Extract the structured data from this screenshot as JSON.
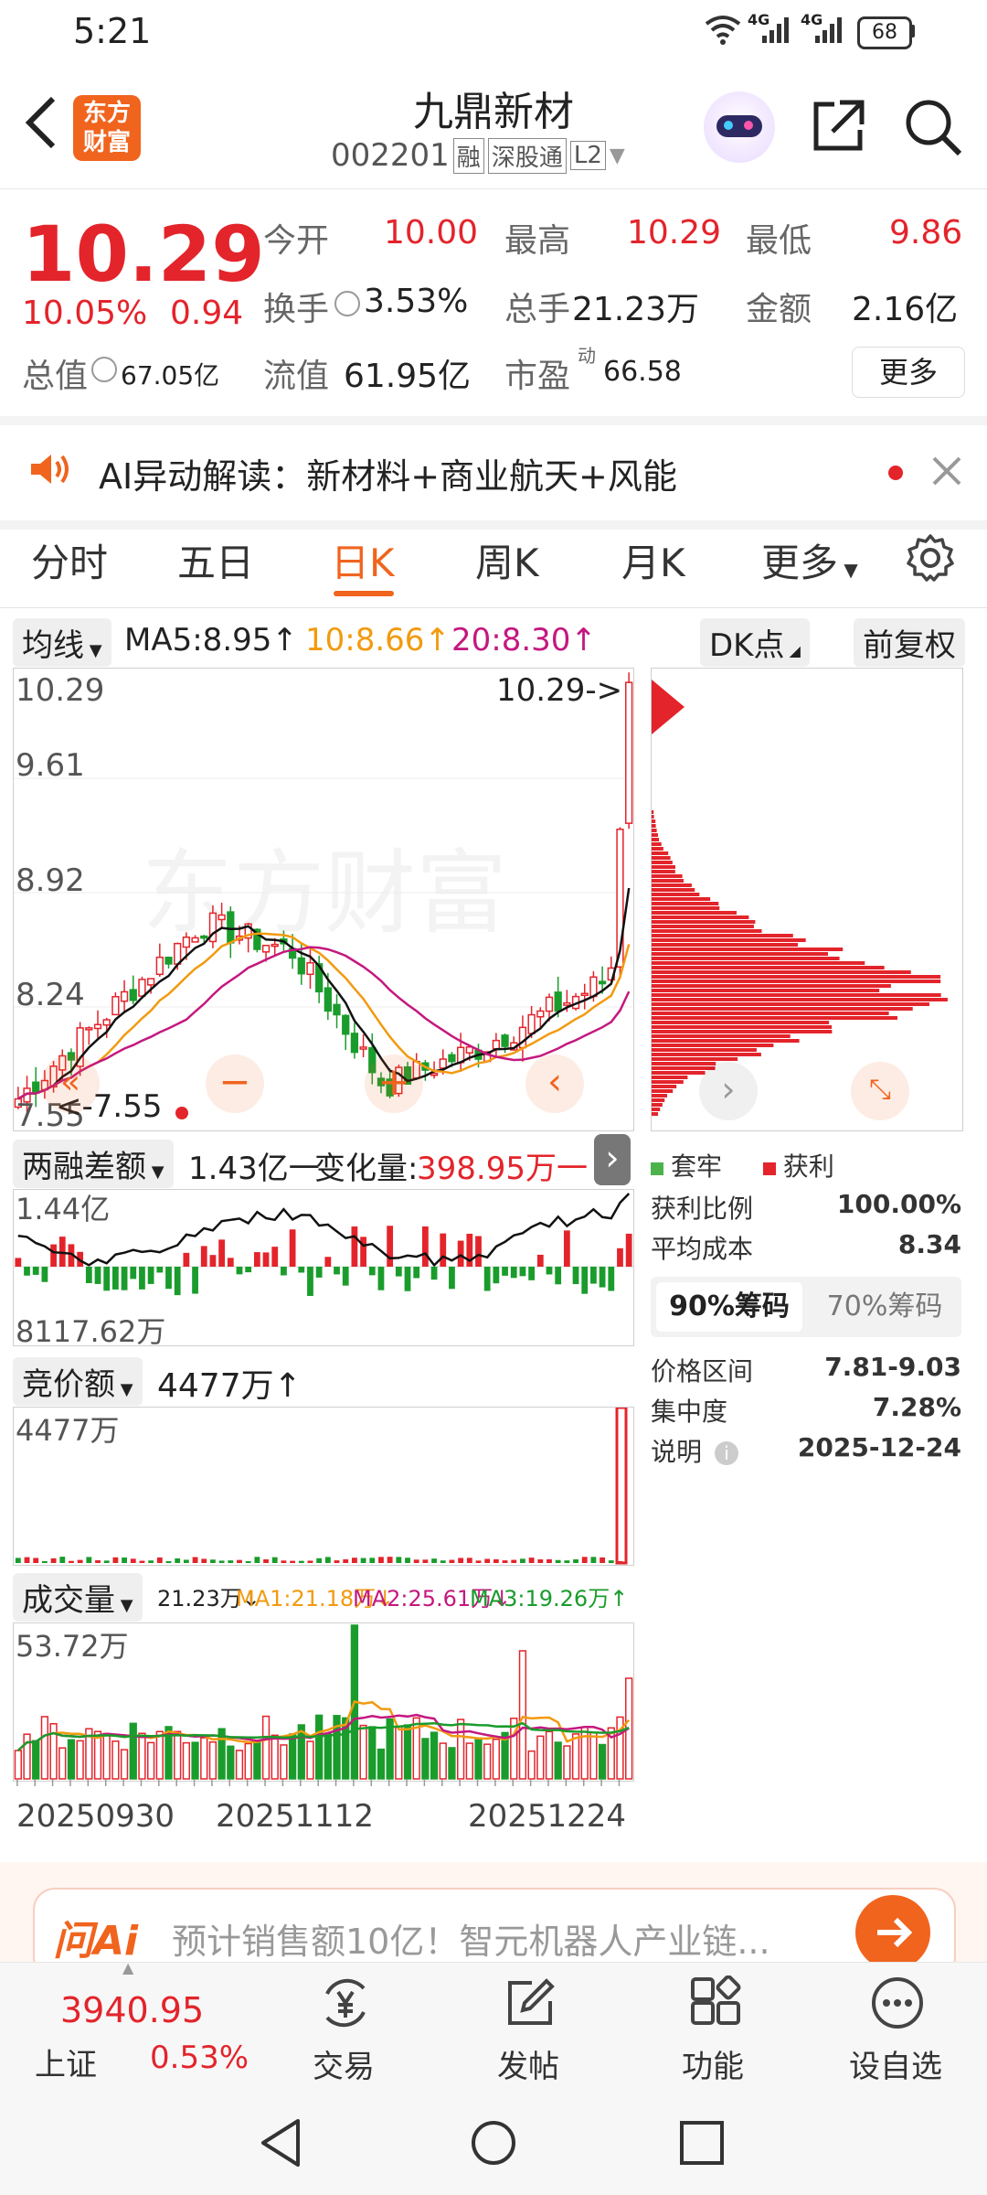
{
  "status": {
    "time": "5:21",
    "battery": "68",
    "net1": "4G",
    "net2": "4G"
  },
  "header": {
    "logo_line1": "东方",
    "logo_line2": "财富",
    "name": "九鼎新材",
    "code": "002201",
    "tags": [
      "融",
      "深股通",
      "L2"
    ]
  },
  "quote": {
    "price": "10.29",
    "change_pct": "10.05%",
    "change": "0.94",
    "open_label": "今开",
    "open": "10.00",
    "high_label": "最高",
    "high": "10.29",
    "low_label": "最低",
    "low": "9.86",
    "turnover_label": "换手",
    "turnover": "3.53%",
    "volume_label": "总手",
    "volume": "21.23万",
    "amount_label": "金额",
    "amount": "2.16亿",
    "mktcap_label": "总值",
    "mktcap": "67.05亿",
    "float_label": "流值",
    "float": "61.95亿",
    "pe_label": "市盈",
    "pe_sup": "动",
    "pe": "66.58",
    "more_button": "更多"
  },
  "ai_bar": {
    "text": "AI异动解读：新材料+商业航天+风能"
  },
  "tabs": [
    "分时",
    "五日",
    "日K",
    "周K",
    "月K",
    "更多"
  ],
  "active_tab": "日K",
  "kline": {
    "ma_dropdown": "均线",
    "ma5": "MA5:8.95↑",
    "ma10": "10:8.66↑",
    "ma20": "20:8.30↑",
    "dk_button": "DK点",
    "adjust_button": "前复权",
    "y_labels": [
      "10.29",
      "9.61",
      "8.92",
      "8.24",
      "7.55"
    ],
    "last_price_note": "10.29->",
    "low_note": "<-7.55",
    "watermark": "东方财富"
  },
  "margin": {
    "dropdown": "两融差额",
    "value": "1.43亿一",
    "change_label": "变化量:",
    "change": "398.95万一",
    "y_top": "1.44亿",
    "y_bottom": "8117.62万"
  },
  "auction": {
    "dropdown": "竞价额",
    "value": "4477万↑",
    "y_top": "4477万"
  },
  "vol": {
    "dropdown": "成交量",
    "value": "21.23万↓",
    "ma1": "MA1:21.18万↓",
    "ma2": "MA2:25.61万↓",
    "ma3": "MA3:19.26万↑",
    "y_top": "53.72万"
  },
  "dates": [
    "20250930",
    "20251112",
    "20251224"
  ],
  "chips": {
    "legend_trapped": "套牢",
    "legend_profit": "获利",
    "rows": [
      {
        "label": "获利比例",
        "value": "100.00%"
      },
      {
        "label": "平均成本",
        "value": "8.34"
      }
    ],
    "tab1": "90%筹码",
    "tab2": "70%筹码",
    "rows2": [
      {
        "label": "价格区间",
        "value": "7.81-9.03"
      },
      {
        "label": "集中度",
        "value": "7.28%"
      },
      {
        "label": "说明",
        "value": "2025-12-24"
      }
    ]
  },
  "ask_ai": {
    "logo": "问Ai",
    "text": "预计销售额10亿！智元机器人产业链..."
  },
  "bottom_nav": {
    "index_value": "3940.95",
    "index_name": "上证",
    "index_pct": "0.53%",
    "items": [
      "交易",
      "发帖",
      "功能",
      "设自选"
    ]
  },
  "colors": {
    "up": "#e3242b",
    "down": "#1a9c2c",
    "ma10": "#f29a0f",
    "ma20": "#c4187f",
    "accent": "#f0641e"
  }
}
